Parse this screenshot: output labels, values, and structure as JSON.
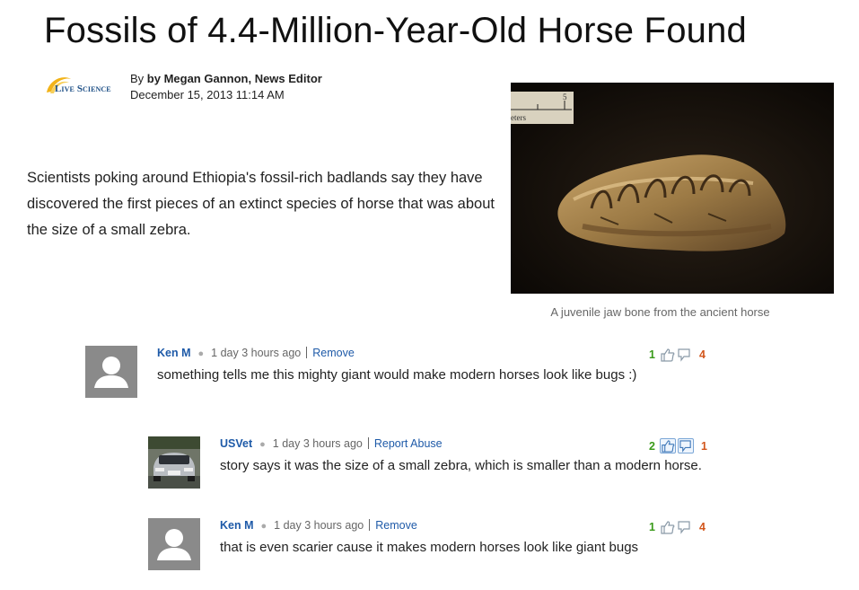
{
  "article": {
    "title": "Fossils of 4.4-Million-Year-Old Horse Found",
    "source_logo_text": "Live Science",
    "byline_prefix": "By ",
    "author": "by Megan Gannon, News Editor",
    "date": "December 15, 2013 11:14 AM",
    "lede": "Scientists poking around Ethiopia's fossil-rich badlands say they have discovered the first pieces of an extinct species of horse that was about the size of a small zebra.",
    "image": {
      "scale_text": "eters",
      "scale_number": "5",
      "caption": "A juvenile jaw bone from the ancient horse"
    }
  },
  "comments": [
    {
      "user": "Ken M",
      "time": "1 day 3 hours ago",
      "action": "Remove",
      "text": "something tells me this mighty giant would make modern horses look like bugs :)",
      "upvotes": "1",
      "downvotes": "4",
      "avatar": "default-person-icon"
    },
    {
      "user": "USVet",
      "time": "1 day 3 hours ago",
      "action": "Report Abuse",
      "text": "story says it was the size of a small zebra, which is smaller than a modern horse.",
      "upvotes": "2",
      "downvotes": "1",
      "avatar": "car-photo"
    },
    {
      "user": "Ken M",
      "time": "1 day 3 hours ago",
      "action": "Remove",
      "text": "that is even scarier cause it makes modern horses look like giant bugs",
      "upvotes": "1",
      "downvotes": "4",
      "avatar": "default-person-icon"
    }
  ],
  "colors": {
    "link": "#1e5aa8",
    "upvote": "#3a9a1a",
    "downvote": "#d2561c",
    "logo_swoosh": "#f2b318"
  }
}
